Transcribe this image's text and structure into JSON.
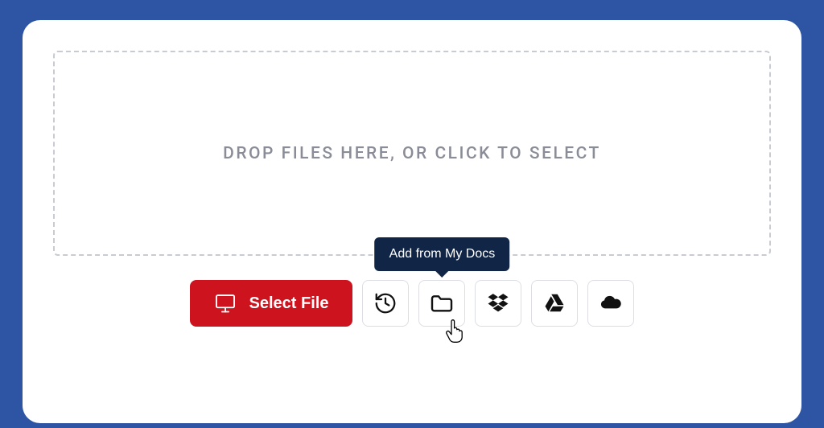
{
  "dropzone": {
    "text": "DROP FILES HERE, OR CLICK TO SELECT"
  },
  "actions": {
    "select_file_label": "Select File",
    "tooltip_my_docs": "Add from My Docs"
  }
}
